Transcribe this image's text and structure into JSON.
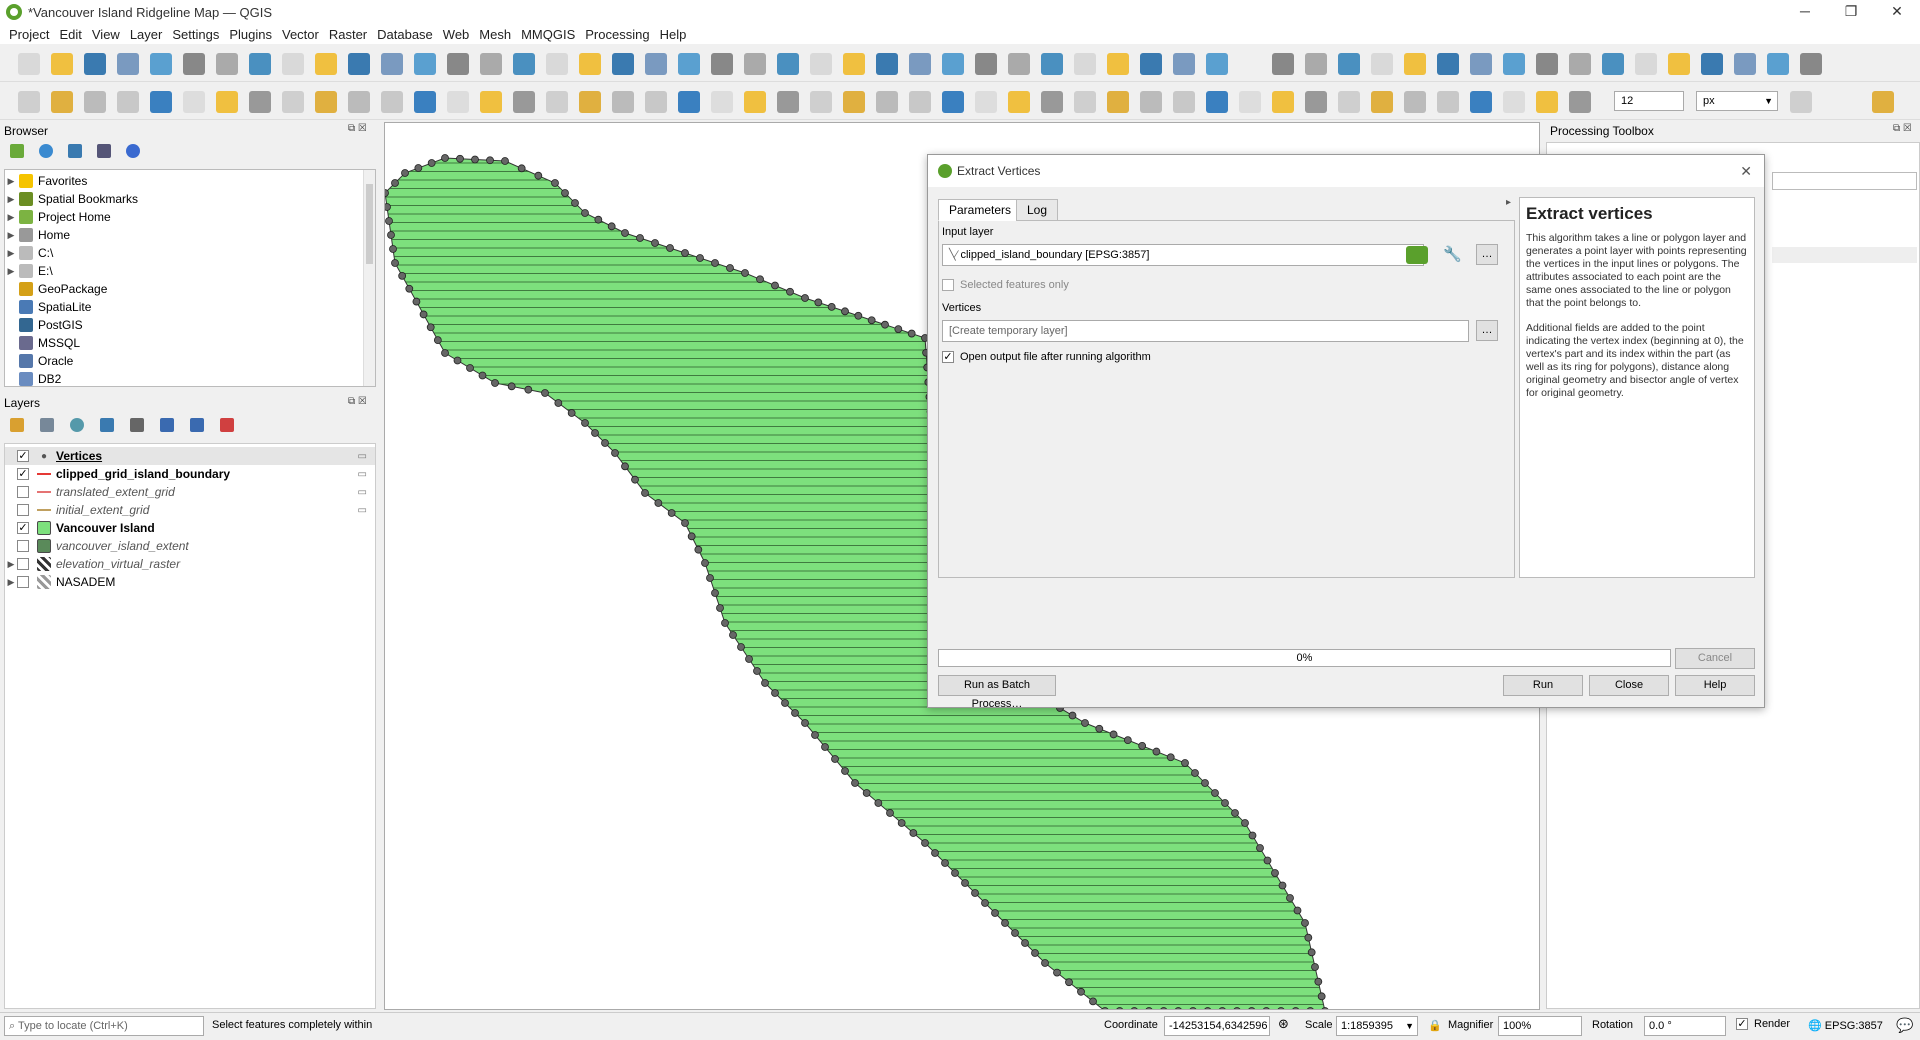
{
  "window": {
    "title": "*Vancouver Island Ridgeline Map — QGIS"
  },
  "menu": [
    "Project",
    "Edit",
    "View",
    "Layer",
    "Settings",
    "Plugins",
    "Vector",
    "Raster",
    "Database",
    "Web",
    "Mesh",
    "MMQGIS",
    "Processing",
    "Help"
  ],
  "browser": {
    "title": "Browser",
    "items": [
      {
        "label": "Favorites",
        "icon": "star-icon",
        "color": "#f5c400",
        "expand": true
      },
      {
        "label": "Spatial Bookmarks",
        "icon": "bookmark-icon",
        "color": "#6b8e23",
        "expand": true
      },
      {
        "label": "Project Home",
        "icon": "folder-icon",
        "color": "#7cb342",
        "expand": true
      },
      {
        "label": "Home",
        "icon": "home-icon",
        "color": "#999999",
        "expand": true
      },
      {
        "label": "C:\\",
        "icon": "drive-icon",
        "color": "#bbbbbb",
        "expand": true
      },
      {
        "label": "E:\\",
        "icon": "drive-icon",
        "color": "#bbbbbb",
        "expand": true
      },
      {
        "label": "GeoPackage",
        "icon": "geopackage-icon",
        "color": "#d4a017",
        "expand": false
      },
      {
        "label": "SpatiaLite",
        "icon": "spatialite-icon",
        "color": "#4a7ab5",
        "expand": false
      },
      {
        "label": "PostGIS",
        "icon": "postgis-icon",
        "color": "#336791",
        "expand": false
      },
      {
        "label": "MSSQL",
        "icon": "mssql-icon",
        "color": "#6a6a8e",
        "expand": false
      },
      {
        "label": "Oracle",
        "icon": "oracle-icon",
        "color": "#5577aa",
        "expand": false
      },
      {
        "label": "DB2",
        "icon": "db2-icon",
        "color": "#6a8cc0",
        "expand": false
      }
    ]
  },
  "layers": {
    "title": "Layers",
    "items": [
      {
        "label": "Vertices",
        "checked": true,
        "bold": true,
        "italic": false,
        "underline": true,
        "symbol": "point",
        "color": "#555555",
        "expand": false
      },
      {
        "label": "clipped_grid_island_boundary",
        "checked": true,
        "bold": true,
        "italic": false,
        "underline": false,
        "symbol": "line",
        "color": "#e53935",
        "expand": false
      },
      {
        "label": "translated_extent_grid",
        "checked": false,
        "bold": false,
        "italic": true,
        "underline": false,
        "symbol": "line",
        "color": "#e57373",
        "expand": false
      },
      {
        "label": "initial_extent_grid",
        "checked": false,
        "bold": false,
        "italic": true,
        "underline": false,
        "symbol": "line",
        "color": "#c0a060",
        "expand": false
      },
      {
        "label": "Vancouver Island",
        "checked": true,
        "bold": true,
        "italic": false,
        "underline": false,
        "symbol": "fill",
        "color": "#7de07d",
        "expand": false
      },
      {
        "label": "vancouver_island_extent",
        "checked": false,
        "bold": false,
        "italic": true,
        "underline": false,
        "symbol": "fill",
        "color": "#5a8a5a",
        "expand": false
      },
      {
        "label": "elevation_virtual_raster",
        "checked": false,
        "bold": false,
        "italic": true,
        "underline": false,
        "symbol": "raster",
        "color": "#333333",
        "expand": true
      },
      {
        "label": "NASADEM",
        "checked": false,
        "bold": false,
        "italic": false,
        "underline": false,
        "symbol": "raster-gray",
        "color": "#999999",
        "expand": true
      }
    ]
  },
  "toolbar": {
    "snap_tolerance": "12",
    "snap_unit": "px"
  },
  "processing_toolbox": {
    "title": "Processing Toolbox"
  },
  "dialog": {
    "title": "Extract Vertices",
    "tabs": [
      "Parameters",
      "Log"
    ],
    "input_layer_label": "Input layer",
    "input_layer_value": "clipped_island_boundary [EPSG:3857]",
    "selected_only_label": "Selected features only",
    "vertices_label": "Vertices",
    "vertices_placeholder": "[Create temporary layer]",
    "open_output_label": "Open output file after running algorithm",
    "progress": "0%",
    "progress_value": 0,
    "cancel": "Cancel",
    "batch": "Run as Batch Process…",
    "run": "Run",
    "close": "Close",
    "help": "Help",
    "help_title": "Extract vertices",
    "help_p1": "This algorithm takes a line or polygon layer and generates a point layer with points representing the vertices in the input lines or polygons. The attributes associated to each point are the same ones associated to the line or polygon that the point belongs to.",
    "help_p2": "Additional fields are added to the point indicating the vertex index (beginning at 0), the vertex's part and its index within the part (as well as its ring for polygons), distance along original geometry and bisector angle of vertex for original geometry."
  },
  "status": {
    "locate_placeholder": "Type to locate (Ctrl+K)",
    "message": "Select features completely within",
    "coordinate_label": "Coordinate",
    "coordinate": "-14253154,6342596",
    "scale_label": "Scale",
    "scale": "1:1859395",
    "magnifier_label": "Magnifier",
    "magnifier": "100%",
    "rotation_label": "Rotation",
    "rotation": "0.0 °",
    "render_label": "Render",
    "crs": "EPSG:3857"
  },
  "colors": {
    "island_fill": "#7de07d",
    "grid_line": "#2d5a2d",
    "vertex": "#666666"
  }
}
